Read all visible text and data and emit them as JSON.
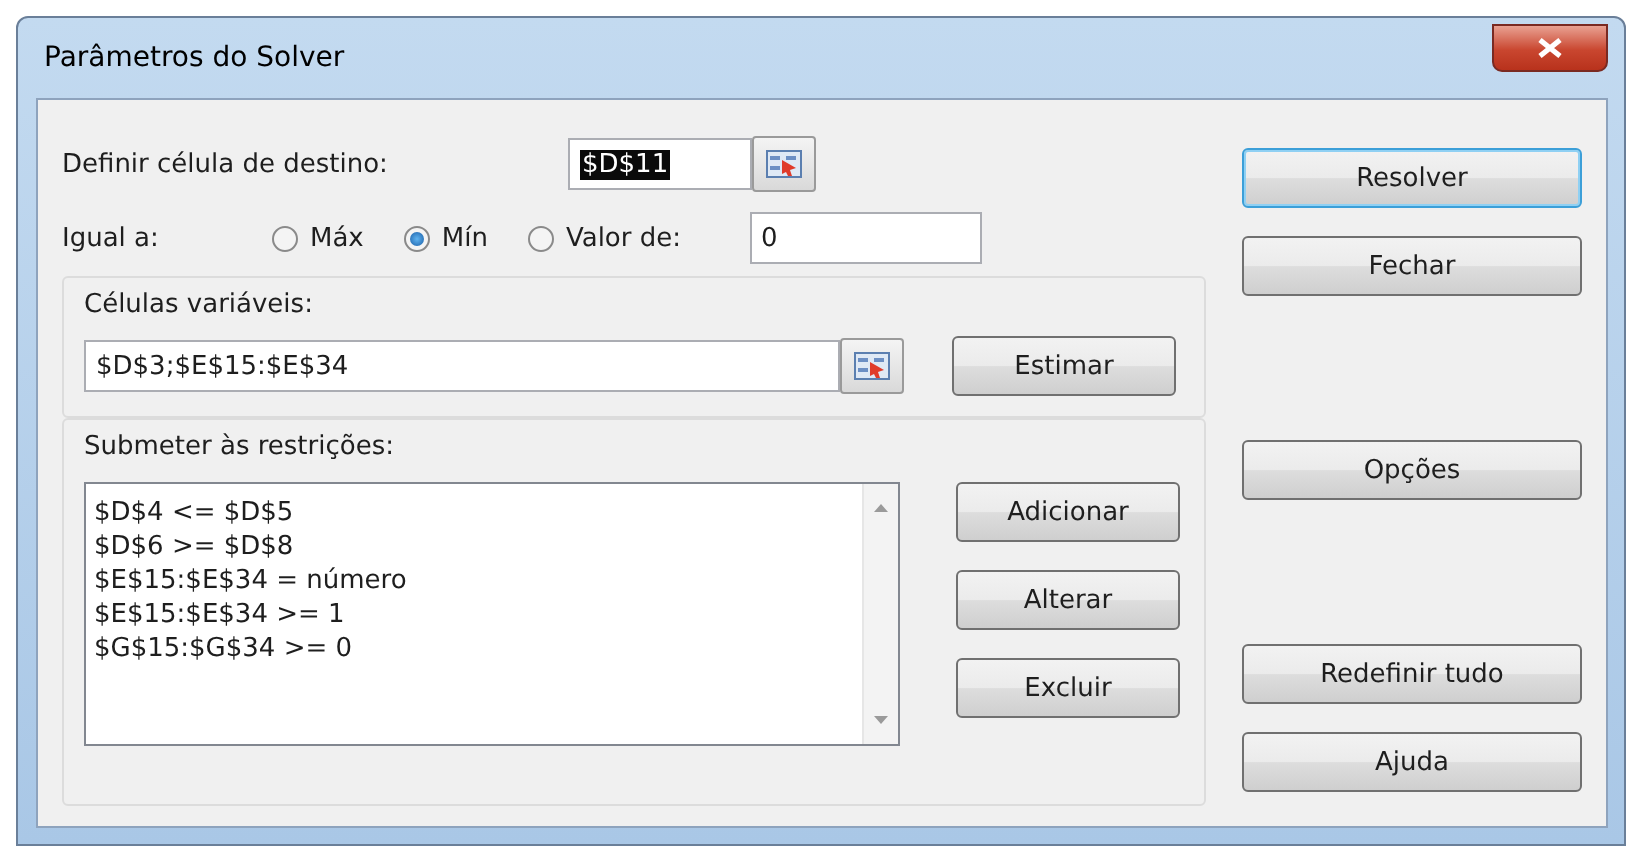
{
  "window": {
    "title": "Parâmetros do Solver"
  },
  "target": {
    "label": "Definir célula de destino:",
    "value": "$D$11",
    "text_selected": true
  },
  "equal_to": {
    "label": "Igual a:",
    "options": [
      {
        "label": "Máx",
        "selected": false
      },
      {
        "label": "Mín",
        "selected": true
      },
      {
        "label": "Valor de:",
        "selected": false
      }
    ],
    "value": "0"
  },
  "variable_cells": {
    "label": "Células variáveis:",
    "value": "$D$3;$E$15:$E$34",
    "button": "Estimar"
  },
  "constraints": {
    "label": "Submeter às restrições:",
    "items": [
      "$D$4 <= $D$5",
      "$D$6 >= $D$8",
      "$E$15:$E$34 = número",
      "$E$15:$E$34 >= 1",
      "$G$15:$G$34 >= 0"
    ],
    "buttons": [
      "Adicionar",
      "Alterar",
      "Excluir"
    ]
  },
  "side_buttons": [
    {
      "label": "Resolver",
      "default": true
    },
    {
      "label": "Fechar",
      "default": false
    },
    {
      "label": "Opções",
      "default": false
    },
    {
      "label": "Redefinir tudo",
      "default": false
    },
    {
      "label": "Ajuda",
      "default": false
    }
  ]
}
